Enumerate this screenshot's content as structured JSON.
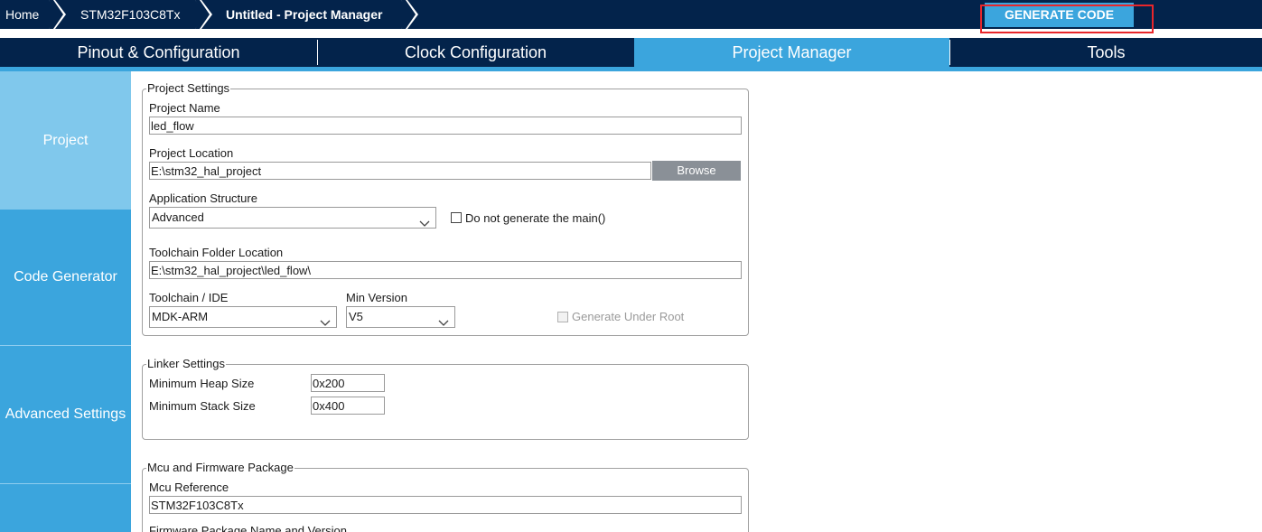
{
  "breadcrumb": {
    "home": "Home",
    "device": "STM32F103C8Tx",
    "project": "Untitled - Project Manager"
  },
  "generate_button": "GENERATE CODE",
  "tabs": [
    {
      "label": "Pinout & Configuration"
    },
    {
      "label": "Clock Configuration"
    },
    {
      "label": "Project Manager"
    },
    {
      "label": "Tools"
    }
  ],
  "active_tab": "Project Manager",
  "sidebar": {
    "items": [
      {
        "label": "Project"
      },
      {
        "label": "Code Generator"
      },
      {
        "label": "Advanced Settings"
      }
    ]
  },
  "project_settings": {
    "legend": "Project Settings",
    "name_label": "Project Name",
    "name_value": "led_flow",
    "location_label": "Project Location",
    "location_value": "E:\\stm32_hal_project",
    "browse_label": "Browse",
    "app_structure_label": "Application Structure",
    "app_structure_value": "Advanced",
    "no_main_label": "Do not generate the main()",
    "toolchain_folder_label": "Toolchain Folder Location",
    "toolchain_folder_value": "E:\\stm32_hal_project\\led_flow\\",
    "toolchain_label": "Toolchain / IDE",
    "toolchain_value": "MDK-ARM",
    "min_version_label": "Min Version",
    "min_version_value": "V5",
    "under_root_label": "Generate Under Root"
  },
  "linker_settings": {
    "legend": "Linker Settings",
    "heap_label": "Minimum Heap Size",
    "heap_value": "0x200",
    "stack_label": "Minimum Stack Size",
    "stack_value": "0x400"
  },
  "mcu_package": {
    "legend": "Mcu and Firmware Package",
    "mcu_ref_label": "Mcu Reference",
    "mcu_ref_value": "STM32F103C8Tx",
    "fw_label": "Firmware Package Name and Version"
  },
  "colors": {
    "navy": "#03234b",
    "accent": "#3ba5dd",
    "sidebar_active": "#80c8ec",
    "highlight": "#e8262b"
  }
}
